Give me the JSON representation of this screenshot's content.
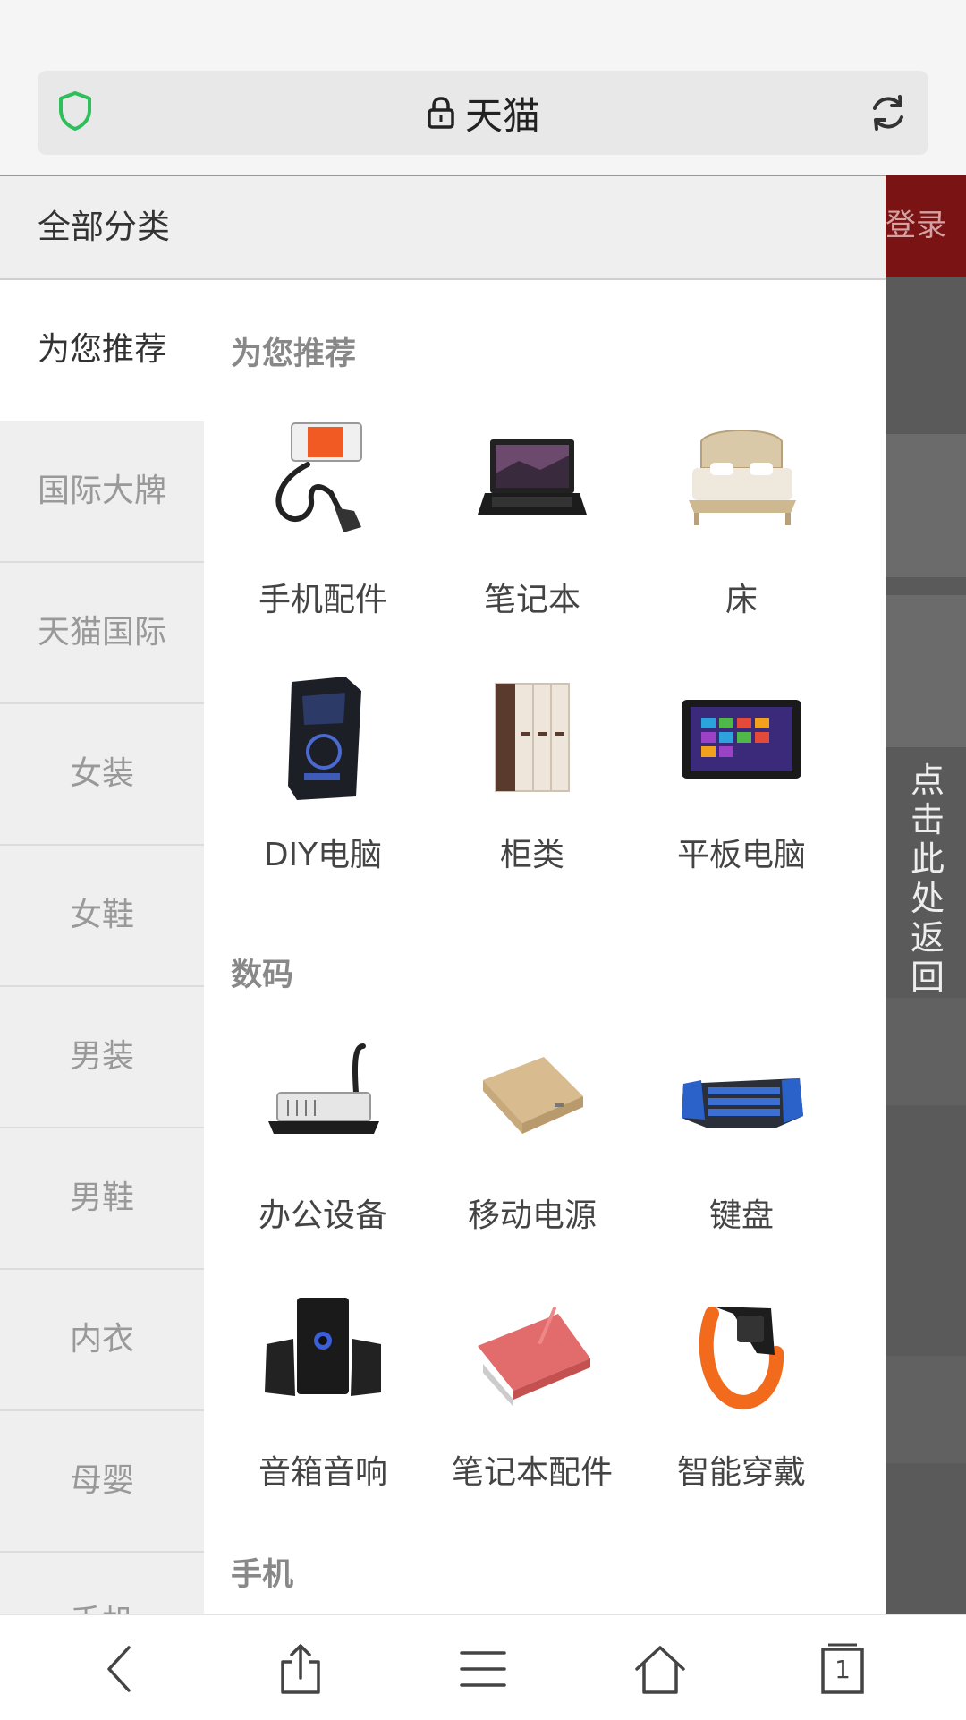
{
  "browser": {
    "title": "天猫",
    "tab_count": "1"
  },
  "background_page": {
    "login_label": "登录",
    "return_label": "点击此处返回"
  },
  "drawer": {
    "header_title": "全部分类",
    "sidebar": [
      "为您推荐",
      "国际大牌",
      "天猫国际",
      "女装",
      "女鞋",
      "男装",
      "男鞋",
      "内衣",
      "母婴",
      "手机"
    ],
    "sections": [
      {
        "title": "为您推荐",
        "items": [
          {
            "label": "手机配件",
            "icon": "phone-holder-icon"
          },
          {
            "label": "笔记本",
            "icon": "laptop-icon"
          },
          {
            "label": "床",
            "icon": "bed-icon"
          },
          {
            "label": "DIY电脑",
            "icon": "pc-tower-icon"
          },
          {
            "label": "柜类",
            "icon": "wardrobe-icon"
          },
          {
            "label": "平板电脑",
            "icon": "tablet-icon"
          }
        ]
      },
      {
        "title": "数码",
        "items": [
          {
            "label": "办公设备",
            "icon": "binding-machine-icon"
          },
          {
            "label": "移动电源",
            "icon": "power-bank-icon"
          },
          {
            "label": "键盘",
            "icon": "keyboard-icon"
          },
          {
            "label": "音箱音响",
            "icon": "speaker-icon"
          },
          {
            "label": "笔记本配件",
            "icon": "laptop-accessory-icon"
          },
          {
            "label": "智能穿戴",
            "icon": "smart-band-icon"
          }
        ]
      },
      {
        "title": "手机"
      }
    ]
  },
  "colors": {
    "shield_green": "#2fbf5a",
    "login_red": "#b31b1b"
  }
}
